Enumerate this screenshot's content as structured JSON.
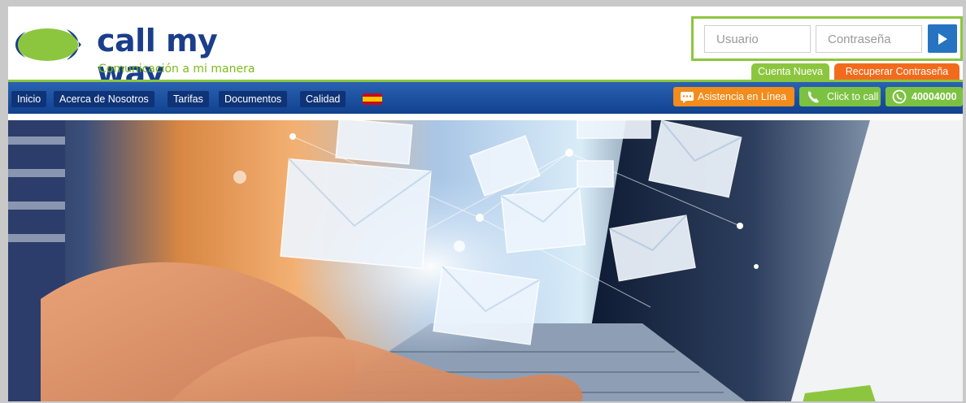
{
  "logo": {
    "title": "call my way",
    "tagline": "Comunicación a mi manera"
  },
  "login": {
    "user_placeholder": "Usuario",
    "password_placeholder": "Contraseña",
    "new_account_label": "Cuenta Nueva",
    "recover_label": "Recuperar Contraseña"
  },
  "nav": {
    "items": [
      "Inicio",
      "Acerca de Nosotros",
      "Tarifas",
      "Documentos",
      "Calidad"
    ]
  },
  "contact": {
    "support_label": "Asistencia en Línea",
    "click_to_call_label": "Click to call",
    "whatsapp_number": "40004000"
  },
  "colors": {
    "brand_blue": "#1a3e8c",
    "brand_green": "#8cc63f",
    "orange": "#f26b1d",
    "login_button": "#2673c2"
  },
  "icons": [
    "logo-mark-icon",
    "play-arrow-icon",
    "spain-flag-icon",
    "chat-icon",
    "phone-icon",
    "whatsapp-icon"
  ]
}
